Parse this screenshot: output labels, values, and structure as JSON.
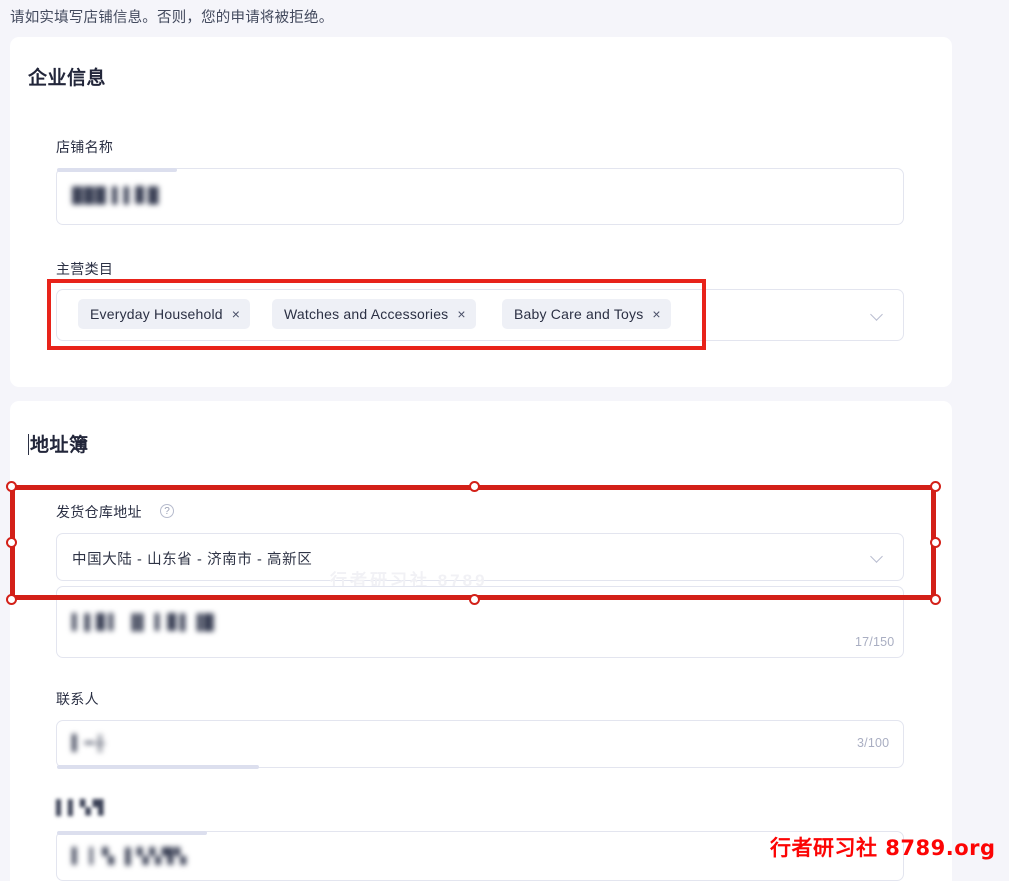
{
  "notice": "请如实填写店铺信息。否则，您的申请将被拒绝。",
  "business_section": {
    "title": "企业信息",
    "shop_name": {
      "label": "店铺名称",
      "value": "███ ▌▌▊█",
      "redacted": true
    },
    "main_category": {
      "label": "主营类目",
      "tags": [
        {
          "label": "Everyday Household",
          "remove_icon": "×"
        },
        {
          "label": "Watches and Accessories",
          "remove_icon": "×"
        },
        {
          "label": "Baby Care and Toys",
          "remove_icon": "×"
        }
      ],
      "dropdown_icon": "chevron-down"
    }
  },
  "address_section": {
    "title": "地址簿",
    "warehouse_address": {
      "label": "发货仓库地址",
      "help_icon": "?",
      "value": "中国大陆 - 山东省 - 济南市 - 高新区",
      "dropdown_icon": "chevron-down"
    },
    "detail_address": {
      "value": "▍▌▊▍ ▐▌ ▍▊▌▐█",
      "counter": "17/150",
      "redacted": true
    },
    "contact": {
      "label": "联系人",
      "value": "▍━╫",
      "counter": "3/100",
      "redacted": true
    },
    "phone": {
      "label": "▌▌▚▜",
      "value": "▍ ▎▚ ▐ ▚▚▜▚",
      "redacted": true
    }
  },
  "annotations": {
    "category_highlight_color": "#e8231a",
    "address_selection_color": "#d32018"
  },
  "watermark": {
    "text": "行者研习社 8789.org",
    "color": "#fc0404"
  },
  "background_watermark": "行者研习社 8789"
}
